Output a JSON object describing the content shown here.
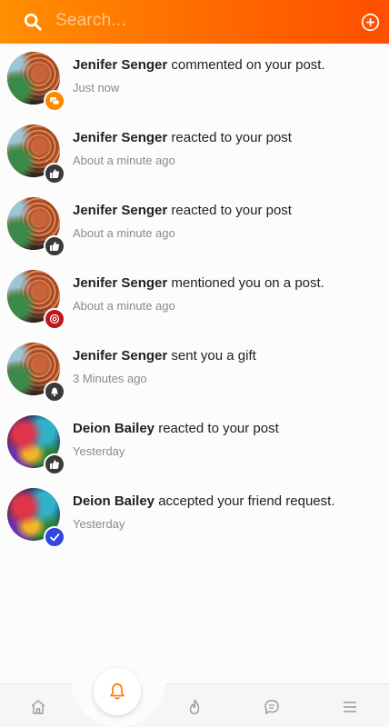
{
  "search": {
    "placeholder": "Search..."
  },
  "colors": {
    "accent": "#ff7a00",
    "nav_icon": "#9a9a9a"
  },
  "notifications": [
    {
      "name": "Jenifer Senger",
      "action": "commented on your post.",
      "time": "Just now",
      "avatar": "jenifer-senger-avatar",
      "badge_icon": "comment-icon",
      "badge_color": "#ff8a00"
    },
    {
      "name": "Jenifer Senger",
      "action": "reacted to your post",
      "time": "About a minute ago",
      "avatar": "jenifer-senger-avatar",
      "badge_icon": "thumbs-up-icon",
      "badge_color": "#3a3a3a"
    },
    {
      "name": "Jenifer Senger",
      "action": "reacted to your post",
      "time": "About a minute ago",
      "avatar": "jenifer-senger-avatar",
      "badge_icon": "thumbs-up-icon",
      "badge_color": "#3a3a3a"
    },
    {
      "name": "Jenifer Senger",
      "action": "mentioned you on a post.",
      "time": "About a minute ago",
      "avatar": "jenifer-senger-avatar",
      "badge_icon": "at-sign-icon",
      "badge_color": "#c0151a"
    },
    {
      "name": "Jenifer Senger",
      "action": "sent you a gift",
      "time": "3 Minutes ago",
      "avatar": "jenifer-senger-avatar",
      "badge_icon": "gift-icon",
      "badge_color": "#3a3a3a"
    },
    {
      "name": "Deion Bailey",
      "action": "reacted to your post",
      "time": "Yesterday",
      "avatar": "deion-bailey-avatar",
      "badge_icon": "thumbs-up-icon",
      "badge_color": "#3a3a3a"
    },
    {
      "name": "Deion Bailey",
      "action": "accepted your friend request.",
      "time": "Yesterday",
      "avatar": "deion-bailey-avatar",
      "badge_icon": "check-icon",
      "badge_color": "#3046e0"
    }
  ],
  "bottom_nav": {
    "items": [
      "home-icon",
      "notifications-bell-icon",
      "trending-flame-icon",
      "messages-icon",
      "menu-icon"
    ],
    "active": "notifications-bell-icon"
  }
}
